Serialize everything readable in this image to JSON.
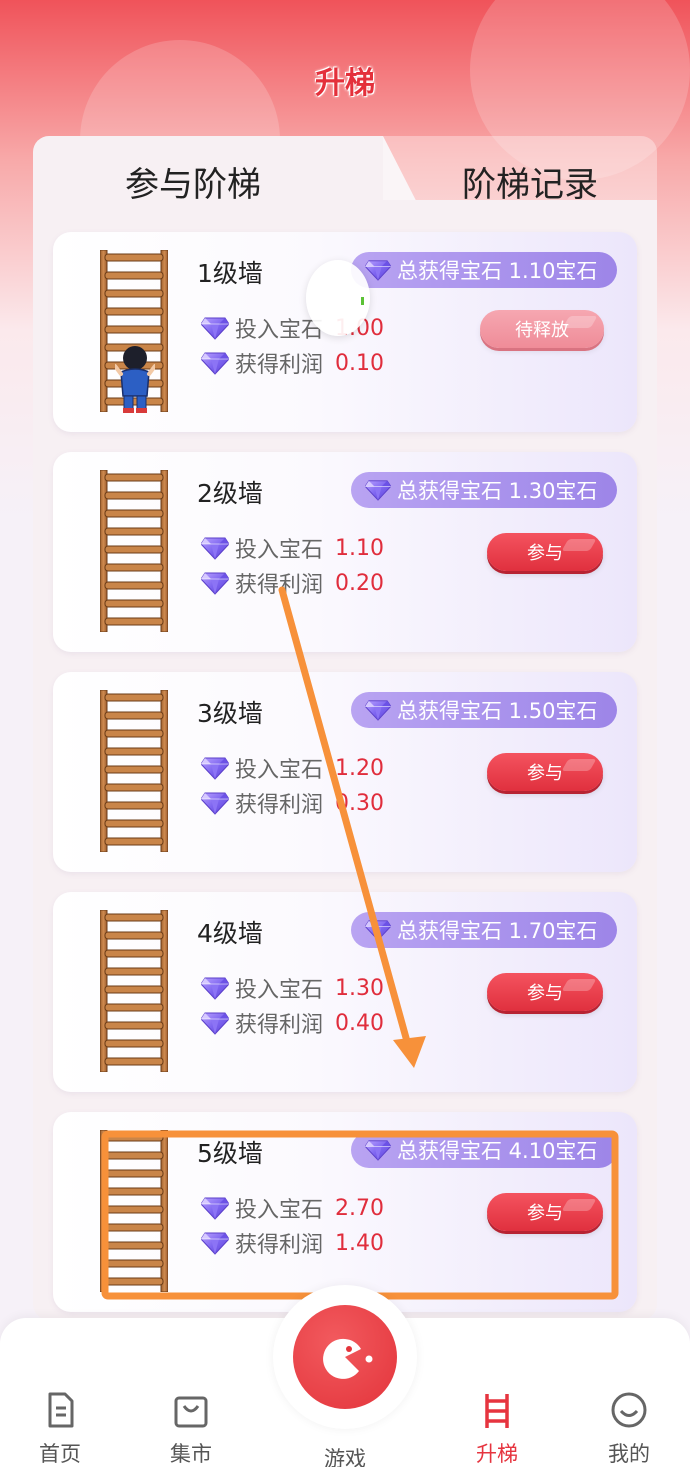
{
  "header": {
    "title": "升梯"
  },
  "tabs": {
    "join": "参与阶梯",
    "record": "阶梯记录"
  },
  "cards": [
    {
      "level": "1级墙",
      "total_label": "总获得宝石 1.10宝石",
      "invest_label": "投入宝石",
      "invest_value": "1.00",
      "profit_label": "获得利润",
      "profit_value": "0.10",
      "button": "待释放",
      "has_avatar": true
    },
    {
      "level": "2级墙",
      "total_label": "总获得宝石 1.30宝石",
      "invest_label": "投入宝石",
      "invest_value": "1.10",
      "profit_label": "获得利润",
      "profit_value": "0.20",
      "button": "参与"
    },
    {
      "level": "3级墙",
      "total_label": "总获得宝石 1.50宝石",
      "invest_label": "投入宝石",
      "invest_value": "1.20",
      "profit_label": "获得利润",
      "profit_value": "0.30",
      "button": "参与"
    },
    {
      "level": "4级墙",
      "total_label": "总获得宝石 1.70宝石",
      "invest_label": "投入宝石",
      "invest_value": "1.30",
      "profit_label": "获得利润",
      "profit_value": "0.40",
      "button": "参与"
    },
    {
      "level": "5级墙",
      "total_label": "总获得宝石 4.10宝石",
      "invest_label": "投入宝石",
      "invest_value": "2.70",
      "profit_label": "获得利润",
      "profit_value": "1.40",
      "button": "参与"
    }
  ],
  "nav": {
    "home": "首页",
    "market": "集市",
    "games": "游戏",
    "ladder": "升梯",
    "mine": "我的"
  },
  "colors": {
    "accent_red": "#e4303b",
    "pill_purple": "#a891ee",
    "annotation_orange": "#f7913a"
  },
  "icons": [
    "document-icon",
    "bag-icon",
    "pacman-icon",
    "ladder-icon",
    "smile-icon",
    "gem-icon"
  ]
}
